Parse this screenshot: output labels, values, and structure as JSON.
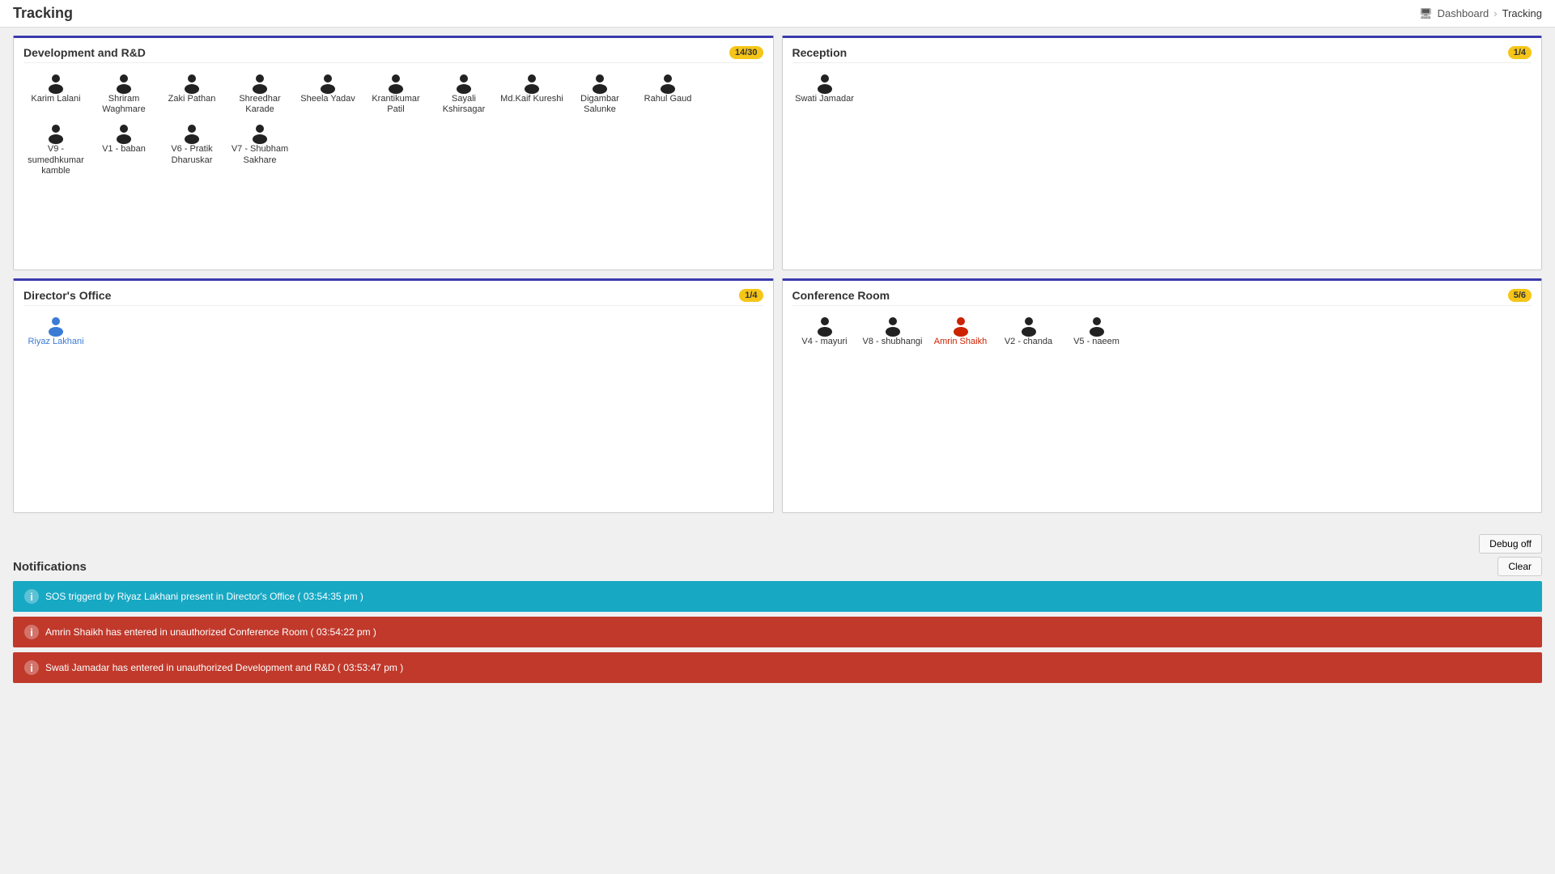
{
  "nav": {
    "title": "Tracking",
    "breadcrumb_dashboard": "Dashboard",
    "breadcrumb_sep": "›",
    "breadcrumb_current": "Tracking",
    "dashboard_icon": "🖥"
  },
  "rooms": [
    {
      "id": "dev-rnd",
      "title": "Development and R&D",
      "badge": "14/30",
      "persons": [
        {
          "name": "Karim Lalani",
          "color": "normal"
        },
        {
          "name": "Shriram Waghmare",
          "color": "normal"
        },
        {
          "name": "Zaki Pathan",
          "color": "normal"
        },
        {
          "name": "Shreedhar Karade",
          "color": "normal"
        },
        {
          "name": "Sheela Yadav",
          "color": "normal"
        },
        {
          "name": "Krantikumar Patil",
          "color": "normal"
        },
        {
          "name": "Sayali Kshirsagar",
          "color": "normal"
        },
        {
          "name": "Md.Kaif Kureshi",
          "color": "normal"
        },
        {
          "name": "Digambar Salunke",
          "color": "normal"
        },
        {
          "name": "Rahul Gaud",
          "color": "normal"
        },
        {
          "name": "V9 - sumedhkumar kamble",
          "color": "normal"
        },
        {
          "name": "V1 - baban",
          "color": "normal"
        },
        {
          "name": "V6 - Pratik Dharuskar",
          "color": "normal"
        },
        {
          "name": "V7 - Shubham Sakhare",
          "color": "normal"
        }
      ]
    },
    {
      "id": "reception",
      "title": "Reception",
      "badge": "1/4",
      "persons": [
        {
          "name": "Swati Jamadar",
          "color": "normal"
        }
      ]
    },
    {
      "id": "directors-office",
      "title": "Director's Office",
      "badge": "1/4",
      "persons": [
        {
          "name": "Riyaz Lakhani",
          "color": "blue"
        }
      ]
    },
    {
      "id": "conference-room",
      "title": "Conference Room",
      "badge": "5/6",
      "persons": [
        {
          "name": "V4 - mayuri",
          "color": "normal"
        },
        {
          "name": "V8 - shubhangi",
          "color": "normal"
        },
        {
          "name": "Amrin Shaikh",
          "color": "red"
        },
        {
          "name": "V2 - chanda",
          "color": "normal"
        },
        {
          "name": "V5 - naeem",
          "color": "normal"
        }
      ]
    }
  ],
  "buttons": {
    "debug_label": "Debug off",
    "clear_label": "Clear"
  },
  "notifications": {
    "title": "Notifications",
    "items": [
      {
        "color": "cyan",
        "text": "SOS triggerd by Riyaz Lakhani present in Director's Office ( 03:54:35 pm )"
      },
      {
        "color": "red",
        "text": "Amrin Shaikh has entered in unauthorized Conference Room ( 03:54:22 pm )"
      },
      {
        "color": "red",
        "text": "Swati Jamadar has entered in unauthorized Development and R&D ( 03:53:47 pm )"
      }
    ]
  }
}
